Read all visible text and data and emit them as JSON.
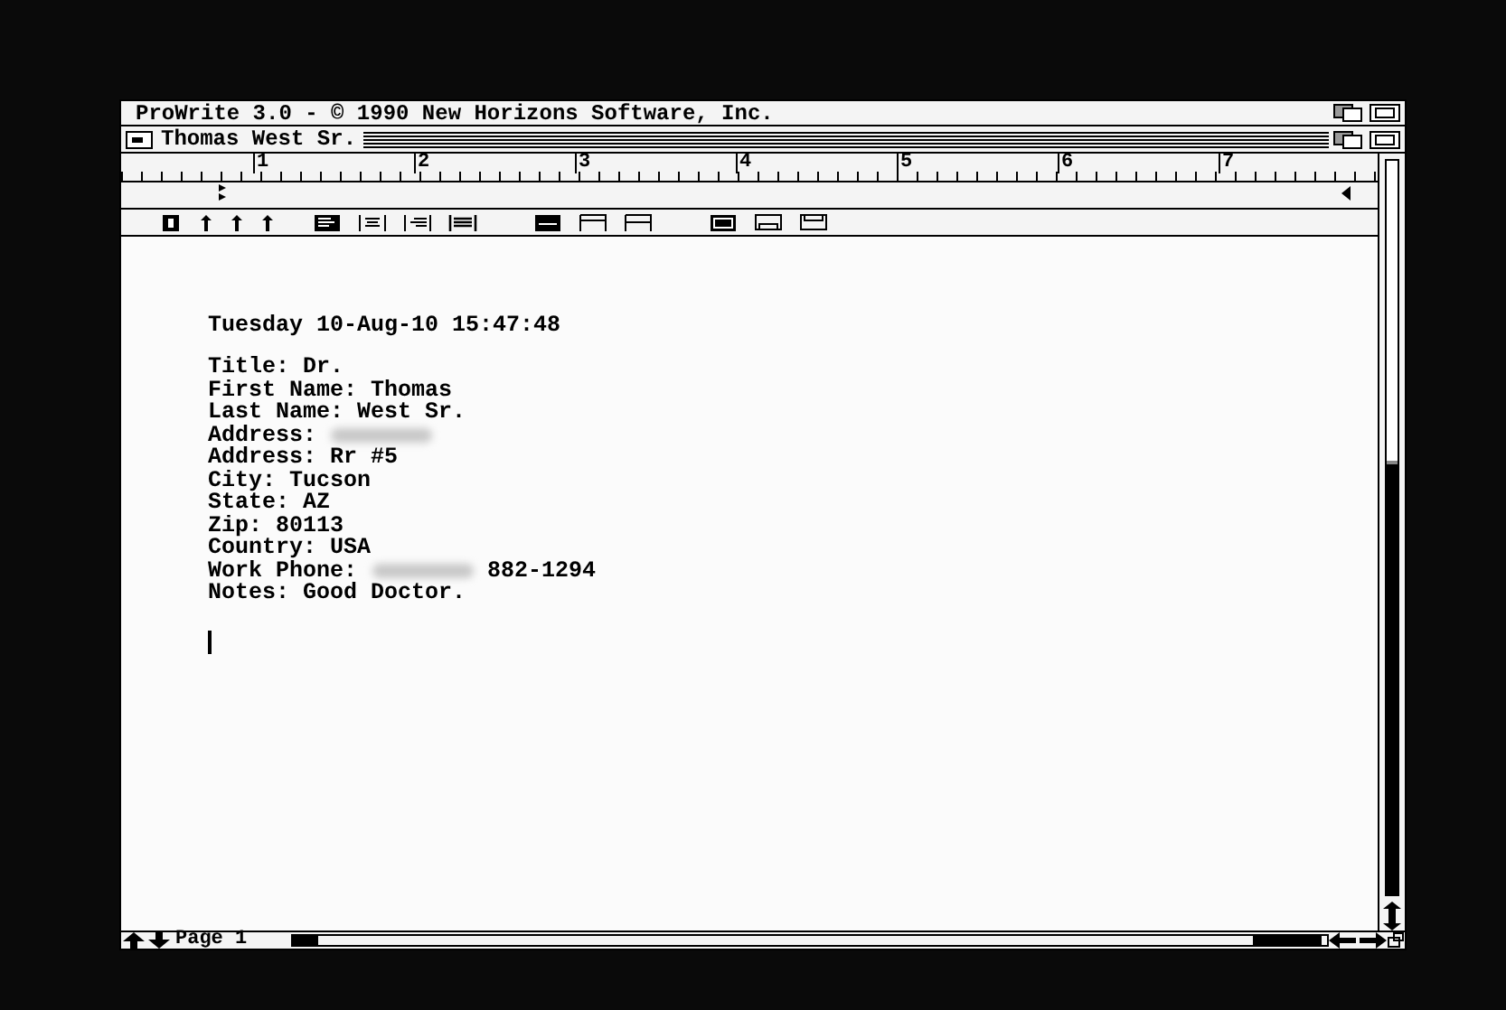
{
  "screen_title": "ProWrite 3.0 - © 1990 New Horizons Software, Inc.",
  "document": {
    "title": "Thomas West Sr.",
    "ruler": [
      "1",
      "2",
      "3",
      "4",
      "5",
      "6",
      "7"
    ],
    "date_line": "Tuesday 10-Aug-10 15:47:48",
    "lines": [
      {
        "parts": [
          {
            "kind": "text",
            "text": "Title: Dr."
          }
        ]
      },
      {
        "parts": [
          {
            "kind": "text",
            "text": "First Name: Thomas"
          }
        ]
      },
      {
        "parts": [
          {
            "kind": "text",
            "text": "Last Name: West Sr."
          }
        ]
      },
      {
        "parts": [
          {
            "kind": "text",
            "text": "Address:"
          },
          {
            "kind": "redacted"
          }
        ]
      },
      {
        "parts": [
          {
            "kind": "text",
            "text": "Address: Rr #5"
          }
        ]
      },
      {
        "parts": [
          {
            "kind": "text",
            "text": "City: Tucson"
          }
        ]
      },
      {
        "parts": [
          {
            "kind": "text",
            "text": "State: AZ"
          }
        ]
      },
      {
        "parts": [
          {
            "kind": "text",
            "text": "Zip: 80113"
          }
        ]
      },
      {
        "parts": [
          {
            "kind": "text",
            "text": "Country: USA"
          }
        ]
      },
      {
        "parts": [
          {
            "kind": "text",
            "text": "Work Phone:"
          },
          {
            "kind": "redacted"
          },
          {
            "kind": "text",
            "text": "882-1294"
          }
        ]
      },
      {
        "parts": [
          {
            "kind": "text",
            "text": "Notes: Good Doctor."
          }
        ]
      }
    ],
    "page_label": "Page 1"
  }
}
